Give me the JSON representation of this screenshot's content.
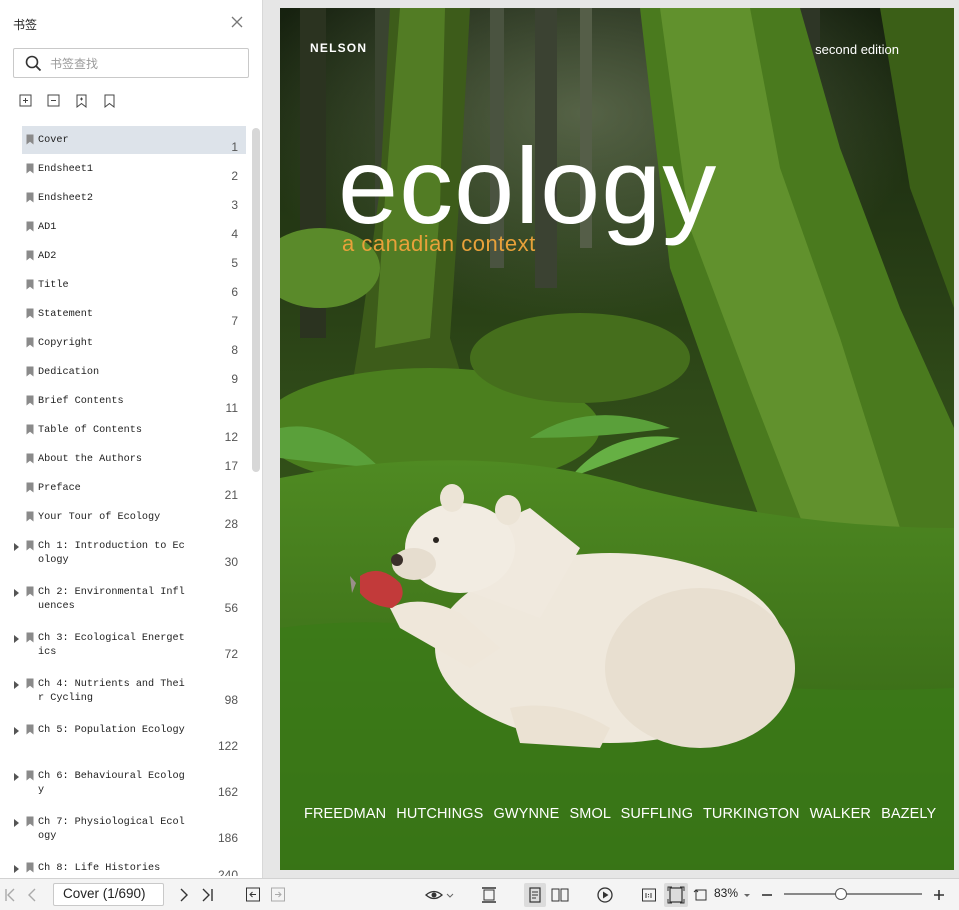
{
  "sidebar": {
    "title": "书签",
    "search_placeholder": "书签查找",
    "tools": [
      "expand-all-icon",
      "collapse-all-icon",
      "add-bookmark-icon",
      "bookmark-icon"
    ],
    "bookmarks": [
      {
        "label": "Cover",
        "page": "1",
        "selected": true
      },
      {
        "label": "Endsheet1",
        "page": "2"
      },
      {
        "label": "Endsheet2",
        "page": "3"
      },
      {
        "label": "AD1",
        "page": "4"
      },
      {
        "label": "AD2",
        "page": "5"
      },
      {
        "label": "Title",
        "page": "6"
      },
      {
        "label": "Statement",
        "page": "7"
      },
      {
        "label": "Copyright",
        "page": "8"
      },
      {
        "label": "Dedication",
        "page": "9"
      },
      {
        "label": "Brief Contents",
        "page": "11"
      },
      {
        "label": "Table of Contents",
        "page": "12"
      },
      {
        "label": "About the Authors",
        "page": "17"
      },
      {
        "label": "Preface",
        "page": "21"
      },
      {
        "label": "Your Tour of Ecology",
        "page": "28"
      },
      {
        "label": "Ch 1: Introduction to Ecology",
        "page": "30",
        "expandable": true
      },
      {
        "label": "Ch 2: Environmental Influences",
        "page": "56",
        "expandable": true
      },
      {
        "label": "Ch 3: Ecological Energetics",
        "page": "72",
        "expandable": true
      },
      {
        "label": "Ch 4: Nutrients and Their Cycling",
        "page": "98",
        "expandable": true
      },
      {
        "label": "Ch 5: Population Ecology",
        "page": "122",
        "expandable": true
      },
      {
        "label": "Ch 6: Behavioural Ecology",
        "page": "162",
        "expandable": true
      },
      {
        "label": "Ch 7: Physiological Ecology",
        "page": "186",
        "expandable": true
      },
      {
        "label": "Ch 8: Life Histories",
        "page": "240",
        "expandable": true
      }
    ]
  },
  "cover": {
    "publisher": "NELSON",
    "edition": "second edition",
    "title": "ecology",
    "subtitle": "a canadian context",
    "authors": "FREEDMAN  HUTCHINGS  GWYNNE  SMOL  SUFFLING  TURKINGTON  WALKER  BAZELY"
  },
  "toolbar": {
    "page_indicator": "Cover (1/690)",
    "zoom": "83%",
    "zoom_fraction": 0.41
  },
  "colors": {
    "accent_subtitle": "#e8a13a",
    "selected_row": "#dde3ea"
  }
}
